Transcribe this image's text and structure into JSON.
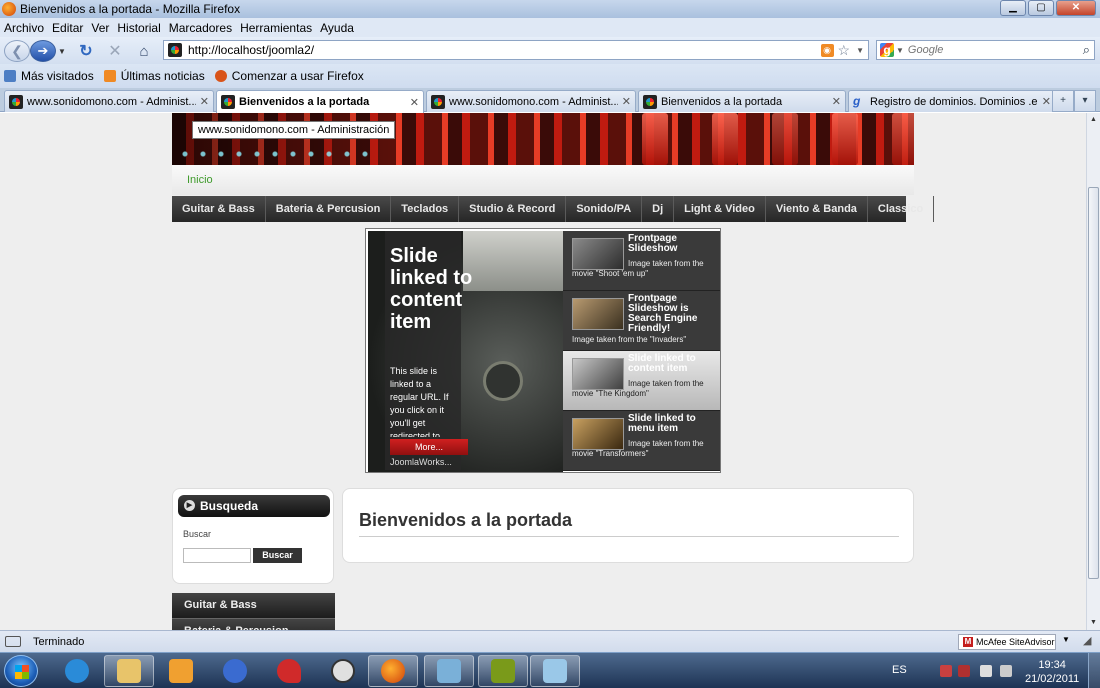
{
  "window": {
    "title": "Bienvenidos a la portada - Mozilla Firefox",
    "minimize_glyph": "▁",
    "maximize_glyph": "▢",
    "close_glyph": "✕"
  },
  "menubar": {
    "items": [
      "Archivo",
      "Editar",
      "Ver",
      "Historial",
      "Marcadores",
      "Herramientas",
      "Ayuda"
    ]
  },
  "navbar": {
    "back_glyph": "❮",
    "forward_glyph": "➔",
    "reload_glyph": "↻",
    "stop_glyph": "✕",
    "home_glyph": "⌂",
    "url": "http://localhost/joomla2/",
    "search_placeholder": "Google",
    "search_icon": "magnifier-icon"
  },
  "bookmarks": {
    "items": [
      {
        "label": "Más visitados",
        "icon": "most-visited-icon",
        "color": "#4d7ec4"
      },
      {
        "label": "Últimas noticias",
        "icon": "rss-icon",
        "color": "#f08a24"
      },
      {
        "label": "Comenzar a usar Firefox",
        "icon": "firefox-icon",
        "color": "#d9541a"
      }
    ]
  },
  "tabs": {
    "items": [
      {
        "label": "www.sonidomono.com - Administ...",
        "icon": "joomla-icon",
        "active": false
      },
      {
        "label": "Bienvenidos a la portada",
        "icon": "joomla-icon",
        "active": true
      },
      {
        "label": "www.sonidomono.com - Administ...",
        "icon": "joomla-icon",
        "active": false
      },
      {
        "label": "Bienvenidos a la portada",
        "icon": "joomla-icon",
        "active": false
      },
      {
        "label": "Registro de dominios. Dominios .e...",
        "icon": "g-icon",
        "active": false
      }
    ],
    "close_glyph": "✕",
    "new_tab_glyph": "+",
    "list_glyph": "▾"
  },
  "page": {
    "tooltip": "www.sonidomono.com - Administración",
    "breadcrumb": "Inicio",
    "main_menu": [
      "Guitar & Bass",
      "Bateria & Percusion",
      "Teclados",
      "Studio & Record",
      "Sonido/PA",
      "Dj",
      "Light & Video",
      "Viento & Banda",
      "Classico"
    ],
    "slideshow": {
      "heading": "Slide linked to content item",
      "text": "This slide is linked to a regular URL. If you click on it you'll get redirected to",
      "more_label": "More...",
      "byline": "JoomlaWorks...",
      "items": [
        {
          "title": "Frontpage Slideshow",
          "desc": "Image taken from the movie \"Shoot 'em up\"",
          "active": false
        },
        {
          "title": "Frontpage Slideshow is Search Engine Friendly!",
          "desc": "Image taken from the \"Invaders\"",
          "active": false
        },
        {
          "title": "Slide linked to content item",
          "desc": "Image taken from the movie \"The Kingdom\"",
          "active": true
        },
        {
          "title": "Slide linked to menu item",
          "desc": "Image taken from the movie \"Transformers\"",
          "active": false
        }
      ]
    },
    "search_module": {
      "title": "Busqueda",
      "label": "Buscar",
      "button": "Buscar",
      "value": ""
    },
    "side_menu": [
      "Guitar & Bass",
      "Bateria & Percusion"
    ],
    "content_title": "Bienvenidos a la portada"
  },
  "statusbar": {
    "status": "Terminado",
    "addon": "McAfee SiteAdvisor",
    "addon_letter": "M"
  },
  "taskbar": {
    "apps": [
      {
        "name": "internet-explorer-icon",
        "color": "#2a8bd8",
        "active": false
      },
      {
        "name": "explorer-folder-icon",
        "color": "#e8c46a",
        "active": false
      },
      {
        "name": "media-player-icon",
        "color": "#f0a030",
        "active": false
      },
      {
        "name": "messenger-icon",
        "color": "#3a6bd0",
        "active": false
      },
      {
        "name": "pin-icon",
        "color": "#d02a2a",
        "active": false
      },
      {
        "name": "clock-app-icon",
        "color": "#e0e0e0",
        "active": false
      },
      {
        "name": "firefox-icon",
        "color": "#e06a18",
        "active": true
      },
      {
        "name": "contacts-icon",
        "color": "#7ab0d8",
        "active": false
      },
      {
        "name": "dreamweaver-icon",
        "color": "#7a9a1a",
        "active": false
      },
      {
        "name": "notepad-icon",
        "color": "#9ac8e8",
        "active": false
      }
    ],
    "language": "ES",
    "time": "19:34",
    "date": "21/02/2011"
  }
}
